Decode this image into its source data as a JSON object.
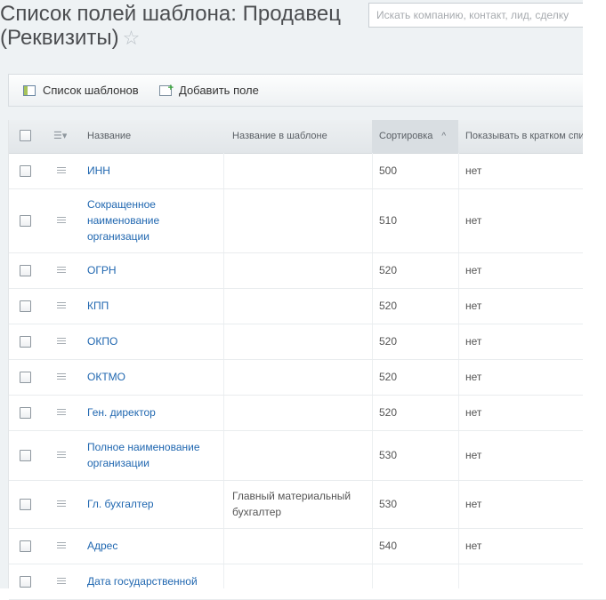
{
  "header": {
    "title": "Список полей шаблона: Продавец (Реквизиты)",
    "star": "☆",
    "search_placeholder": "Искать компанию, контакт, лид, сделку"
  },
  "toolbar": {
    "templates_label": "Список шаблонов",
    "add_field_label": "Добавить поле"
  },
  "grid": {
    "columns": {
      "name": "Название",
      "template_name": "Название в шаблоне",
      "sort": "Сортировка",
      "show": "Показывать в кратком списк"
    },
    "sort_arrow": "^",
    "rows": [
      {
        "name": "ИНН",
        "template_name": "",
        "sort": "500",
        "show": "нет"
      },
      {
        "name": "Сокращенное наименование организации",
        "template_name": "",
        "sort": "510",
        "show": "нет"
      },
      {
        "name": "ОГРН",
        "template_name": "",
        "sort": "520",
        "show": "нет"
      },
      {
        "name": "КПП",
        "template_name": "",
        "sort": "520",
        "show": "нет"
      },
      {
        "name": "ОКПО",
        "template_name": "",
        "sort": "520",
        "show": "нет"
      },
      {
        "name": "ОКТМО",
        "template_name": "",
        "sort": "520",
        "show": "нет"
      },
      {
        "name": "Ген. директор",
        "template_name": "",
        "sort": "520",
        "show": "нет"
      },
      {
        "name": "Полное наименование организации",
        "template_name": "",
        "sort": "530",
        "show": "нет"
      },
      {
        "name": "Гл. бухгалтер",
        "template_name": "Главный материальный бухгалтер",
        "sort": "530",
        "show": "нет"
      },
      {
        "name": "Адрес",
        "template_name": "",
        "sort": "540",
        "show": "нет"
      },
      {
        "name": "Дата государственной",
        "template_name": "",
        "sort": "",
        "show": ""
      }
    ]
  }
}
